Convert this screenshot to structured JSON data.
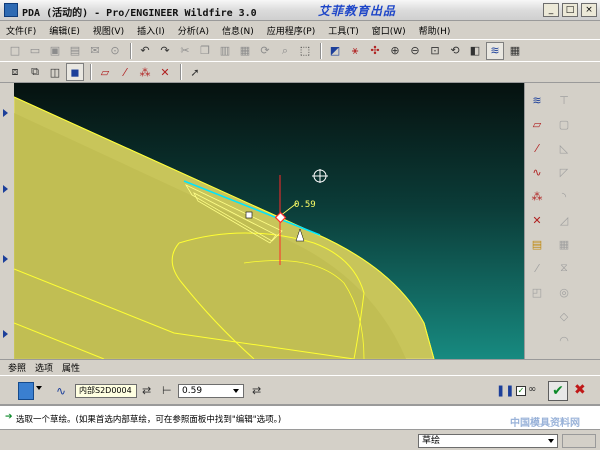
{
  "window": {
    "title": "PDA (活动的) - Pro/ENGINEER Wildfire 3.0",
    "watermark": "艾菲教育出品",
    "controls": [
      "_",
      "□",
      "×"
    ]
  },
  "menu": [
    "文件(F)",
    "编辑(E)",
    "视图(V)",
    "插入(I)",
    "分析(A)",
    "信息(N)",
    "应用程序(P)",
    "工具(T)",
    "窗口(W)",
    "帮助(H)"
  ],
  "toolbar1": {
    "icons": [
      "new-icon",
      "open-icon",
      "save-icon",
      "print-icon",
      "email-icon",
      "link-icon",
      "undo-icon",
      "redo-icon",
      "cut-icon",
      "copy-icon",
      "paste-icon",
      "paste-special-icon",
      "regenerate-icon",
      "find-icon",
      "select-box-icon",
      "sketch-icon",
      "datum-display-icon",
      "spin-center-icon",
      "zoom-in-icon",
      "zoom-out-icon",
      "refit-icon",
      "reorient-icon",
      "saved-views-icon",
      "layers-icon",
      "model-tree-icon"
    ]
  },
  "toolbar2": {
    "icons": [
      "wireframe-icon",
      "hidden-line-icon",
      "no-hidden-icon",
      "shading-icon",
      "datum-plane-icon",
      "datum-axis-icon",
      "datum-point-icon",
      "select-arrow-icon"
    ]
  },
  "viewport": {
    "dimension_value": "0.59",
    "background_top": "#06110f",
    "background_bottom": "#178a80",
    "model_color": "#c8c55a",
    "curve_color": "#ffff33",
    "dimension_color": "#ff2a2a"
  },
  "right_toolbar": {
    "icons": [
      "datum-plane-icon",
      "datum-axis-icon",
      "datum-curve-icon",
      "sketch-icon",
      "datum-point-icon",
      "csys-icon",
      "annotation-icon",
      "analysis-icon",
      "hole-icon",
      "shell-icon",
      "rib-icon",
      "draft-icon",
      "round-icon",
      "chamfer-icon",
      "extrude-icon",
      "revolve-icon",
      "sweep-icon",
      "blend-icon",
      "pattern-icon",
      "mirror-icon",
      "merge-icon",
      "trim-icon",
      "offset-icon",
      "thicken-icon"
    ]
  },
  "dashboard": {
    "tabs": [
      "参照",
      "选项",
      "属性"
    ],
    "sketch_field": "内部S2D0004",
    "depth_value": "0.59"
  },
  "message": {
    "text": "选取一个草绘。(如果首选内部草绘，可在参照面板中找到\"编辑\"选项。)",
    "watermark": "中国模具资料网"
  },
  "status": {
    "filter": "草绘"
  }
}
